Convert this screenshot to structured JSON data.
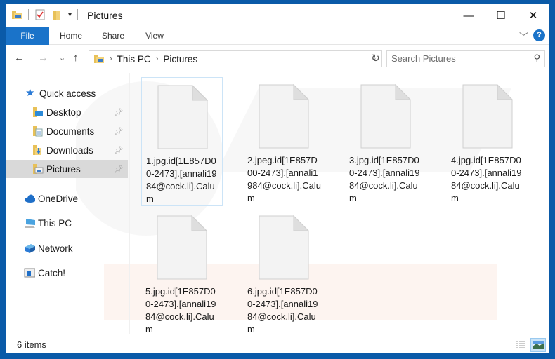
{
  "window": {
    "title": "Pictures",
    "controls": {
      "minimize": "—",
      "maximize": "☐",
      "close": "✕"
    }
  },
  "ribbon": {
    "tabs": [
      {
        "label": "File",
        "active": true
      },
      {
        "label": "Home"
      },
      {
        "label": "Share"
      },
      {
        "label": "View"
      }
    ],
    "expand_icon": "chevron-down-icon",
    "help_label": "?"
  },
  "nav": {
    "back": "←",
    "forward": "→",
    "recent": "⌄",
    "up": "↑",
    "breadcrumb": [
      "This PC",
      "Pictures"
    ],
    "refresh": "↻",
    "search_placeholder": "Search Pictures"
  },
  "sidebar": {
    "items": [
      {
        "label": "Quick access",
        "icon": "star-icon"
      },
      {
        "label": "Desktop",
        "icon": "desktop-folder-icon",
        "pinned": true
      },
      {
        "label": "Documents",
        "icon": "documents-folder-icon",
        "pinned": true
      },
      {
        "label": "Downloads",
        "icon": "downloads-folder-icon",
        "pinned": true
      },
      {
        "label": "Pictures",
        "icon": "pictures-folder-icon",
        "pinned": true,
        "selected": true
      },
      {
        "label": "OneDrive",
        "icon": "cloud-icon"
      },
      {
        "label": "This PC",
        "icon": "computer-icon"
      },
      {
        "label": "Network",
        "icon": "network-icon"
      },
      {
        "label": "Catch!",
        "icon": "window-icon"
      }
    ]
  },
  "files": [
    {
      "name": "1.jpg.id[1E857D00-2473].[annali1984@cock.li].Calum",
      "lines": [
        "1.jpg.id[1E857D0",
        "0-2473].[annali19",
        "84@cock.li].Calu",
        "m"
      ],
      "selected": true
    },
    {
      "name": "2.jpeg.id[1E857D00-2473].[annali1984@cock.li].Calum",
      "lines": [
        "2.jpeg.id[1E857D",
        "00-2473].[annali1",
        "984@cock.li].Calu",
        "m"
      ]
    },
    {
      "name": "3.jpg.id[1E857D00-2473].[annali1984@cock.li].Calum",
      "lines": [
        "3.jpg.id[1E857D0",
        "0-2473].[annali19",
        "84@cock.li].Calu",
        "m"
      ]
    },
    {
      "name": "4.jpg.id[1E857D00-2473].[annali1984@cock.li].Calum",
      "lines": [
        "4.jpg.id[1E857D0",
        "0-2473].[annali19",
        "84@cock.li].Calu",
        "m"
      ]
    },
    {
      "name": "5.jpg.id[1E857D00-2473].[annali1984@cock.li].Calum",
      "lines": [
        "5.jpg.id[1E857D0",
        "0-2473].[annali19",
        "84@cock.li].Calu",
        "m"
      ]
    },
    {
      "name": "6.jpg.id[1E857D00-2473].[annali1984@cock.li].Calum",
      "lines": [
        "6.jpg.id[1E857D0",
        "0-2473].[annali19",
        "84@cock.li].Calu",
        "m"
      ]
    }
  ],
  "status": {
    "item_count": "6 items",
    "views": [
      "details-view-icon",
      "large-icons-view-icon"
    ],
    "active_view": "large-icons-view-icon"
  },
  "colors": {
    "accent": "#1a73c9",
    "frame": "#0a5aa8",
    "selection": "#cce4f7"
  }
}
